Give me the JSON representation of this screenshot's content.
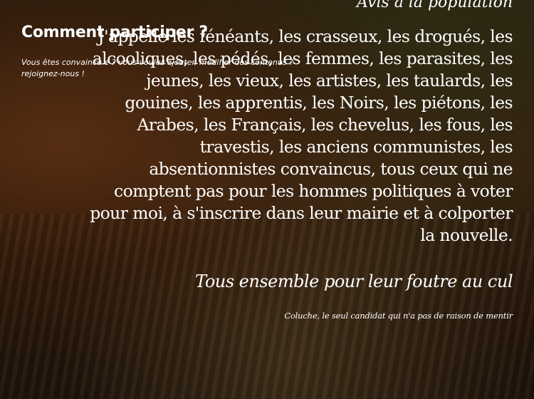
{
  "participate": {
    "title": "Comment participer ?",
    "subtitle": "Vous êtes convaincu.e ? vous voulez ajouter, modifier des contenus ? rejoignez-nous !"
  },
  "poem": {
    "heading": "Avis à la population",
    "body": "J'appelle les fénéants, les crasseux, les drogués, les alcooliques, les pédés, les femmes, les parasites, les jeunes, les vieux, les artistes, les taulards, les gouines, les apprentis, les Noirs, les piétons, les Arabes, les Français, les chevelus, les fous, les travestis, les anciens communistes, les absentionnistes convaincus, tous ceux qui ne comptent pas pour les hommes politiques à voter pour moi, à s'inscrire dans leur mairie et à colporter la nouvelle.",
    "call_to_action": "Tous ensemble pour leur foutre au cul",
    "signature": "Coluche, le seul candidat qui n'a pas de raison de mentir"
  }
}
